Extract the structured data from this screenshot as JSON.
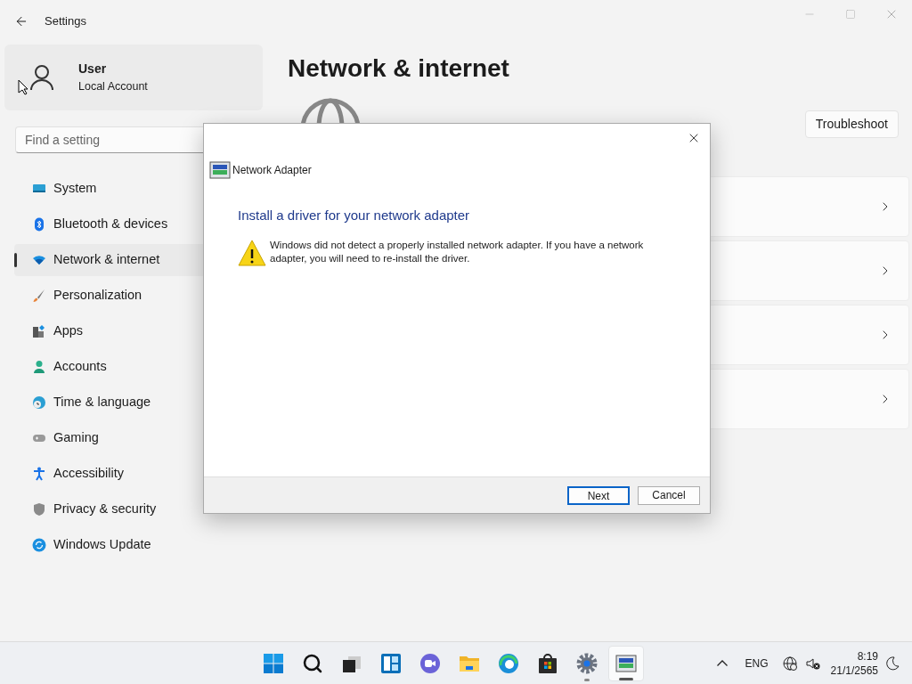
{
  "window": {
    "title": "Settings"
  },
  "user": {
    "name": "User",
    "account": "Local Account"
  },
  "search": {
    "placeholder": "Find a setting"
  },
  "sidebar": {
    "items": [
      {
        "label": "System",
        "kind": "system",
        "selected": false
      },
      {
        "label": "Bluetooth & devices",
        "kind": "bluetooth",
        "selected": false
      },
      {
        "label": "Network & internet",
        "kind": "network",
        "selected": true
      },
      {
        "label": "Personalization",
        "kind": "brush",
        "selected": false
      },
      {
        "label": "Apps",
        "kind": "apps",
        "selected": false
      },
      {
        "label": "Accounts",
        "kind": "accounts",
        "selected": false
      },
      {
        "label": "Time & language",
        "kind": "time",
        "selected": false
      },
      {
        "label": "Gaming",
        "kind": "gaming",
        "selected": false
      },
      {
        "label": "Accessibility",
        "kind": "accessibility",
        "selected": false
      },
      {
        "label": "Privacy & security",
        "kind": "privacy",
        "selected": false
      },
      {
        "label": "Windows Update",
        "kind": "update",
        "selected": false
      }
    ]
  },
  "page": {
    "title": "Network & internet",
    "troubleshoot": "Troubleshoot"
  },
  "dialog": {
    "title": "Network Adapter",
    "heading": "Install a driver for your network adapter",
    "message": "Windows did not detect a properly installed network adapter. If you have a network adapter, you will need to re-install the driver.",
    "buttons": [
      {
        "label": "Next",
        "default": true
      },
      {
        "label": "Cancel",
        "default": false
      }
    ]
  },
  "taskbar": {
    "apps": [
      {
        "kind": "start",
        "running": false,
        "active": false
      },
      {
        "kind": "search",
        "running": false,
        "active": false
      },
      {
        "kind": "taskview",
        "running": false,
        "active": false
      },
      {
        "kind": "widgets",
        "running": false,
        "active": false
      },
      {
        "kind": "chat",
        "running": false,
        "active": false
      },
      {
        "kind": "explorer",
        "running": false,
        "active": false
      },
      {
        "kind": "edge",
        "running": false,
        "active": false
      },
      {
        "kind": "store",
        "running": false,
        "active": false
      },
      {
        "kind": "settings",
        "running": true,
        "active": false
      },
      {
        "kind": "adapter",
        "running": true,
        "active": true
      }
    ],
    "language": "ENG",
    "time": "8:19",
    "date": "21/1/2565"
  }
}
